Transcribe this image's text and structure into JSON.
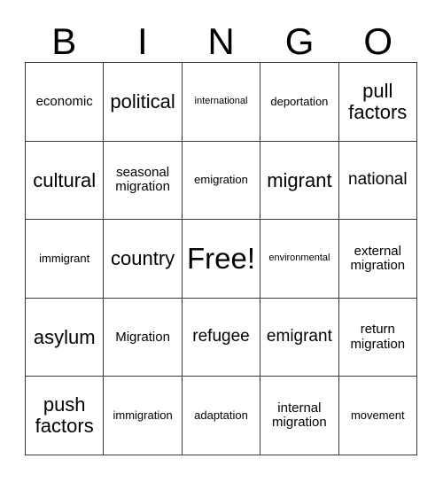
{
  "card": {
    "title": "BINGO",
    "header_letters": [
      "B",
      "I",
      "N",
      "G",
      "O"
    ],
    "grid_size": "5x5",
    "border_color": "#3a3a3a",
    "background_color": "#ffffff",
    "text_color": "#000000",
    "free_space": "Free!",
    "cells": [
      {
        "text": "economic",
        "size": "md",
        "row": 1,
        "col": 1
      },
      {
        "text": "political",
        "size": "xl",
        "row": 1,
        "col": 2
      },
      {
        "text": "international",
        "size": "xs",
        "row": 1,
        "col": 3
      },
      {
        "text": "deportation",
        "size": "sm",
        "row": 1,
        "col": 4
      },
      {
        "text": "pull\nfactors",
        "size": "xl",
        "row": 1,
        "col": 5
      },
      {
        "text": "cultural",
        "size": "xl",
        "row": 2,
        "col": 1
      },
      {
        "text": "seasonal\nmigration",
        "size": "md",
        "row": 2,
        "col": 2
      },
      {
        "text": "emigration",
        "size": "sm",
        "row": 2,
        "col": 3
      },
      {
        "text": "migrant",
        "size": "xl",
        "row": 2,
        "col": 4
      },
      {
        "text": "national",
        "size": "lg",
        "row": 2,
        "col": 5
      },
      {
        "text": "immigrant",
        "size": "sm",
        "row": 3,
        "col": 1
      },
      {
        "text": "country",
        "size": "xl",
        "row": 3,
        "col": 2
      },
      {
        "text": "Free!",
        "size": "free",
        "row": 3,
        "col": 3
      },
      {
        "text": "environmental",
        "size": "xs",
        "row": 3,
        "col": 4
      },
      {
        "text": "external\nmigration",
        "size": "md",
        "row": 3,
        "col": 5
      },
      {
        "text": "asylum",
        "size": "xl",
        "row": 4,
        "col": 1
      },
      {
        "text": "Migration",
        "size": "md",
        "row": 4,
        "col": 2
      },
      {
        "text": "refugee",
        "size": "lg",
        "row": 4,
        "col": 3
      },
      {
        "text": "emigrant",
        "size": "lg",
        "row": 4,
        "col": 4
      },
      {
        "text": "return\nmigration",
        "size": "md",
        "row": 4,
        "col": 5
      },
      {
        "text": "push\nfactors",
        "size": "xl",
        "row": 5,
        "col": 1
      },
      {
        "text": "immigration",
        "size": "sm",
        "row": 5,
        "col": 2
      },
      {
        "text": "adaptation",
        "size": "sm",
        "row": 5,
        "col": 3
      },
      {
        "text": "internal\nmigration",
        "size": "md",
        "row": 5,
        "col": 4
      },
      {
        "text": "movement",
        "size": "sm",
        "row": 5,
        "col": 5
      }
    ]
  }
}
